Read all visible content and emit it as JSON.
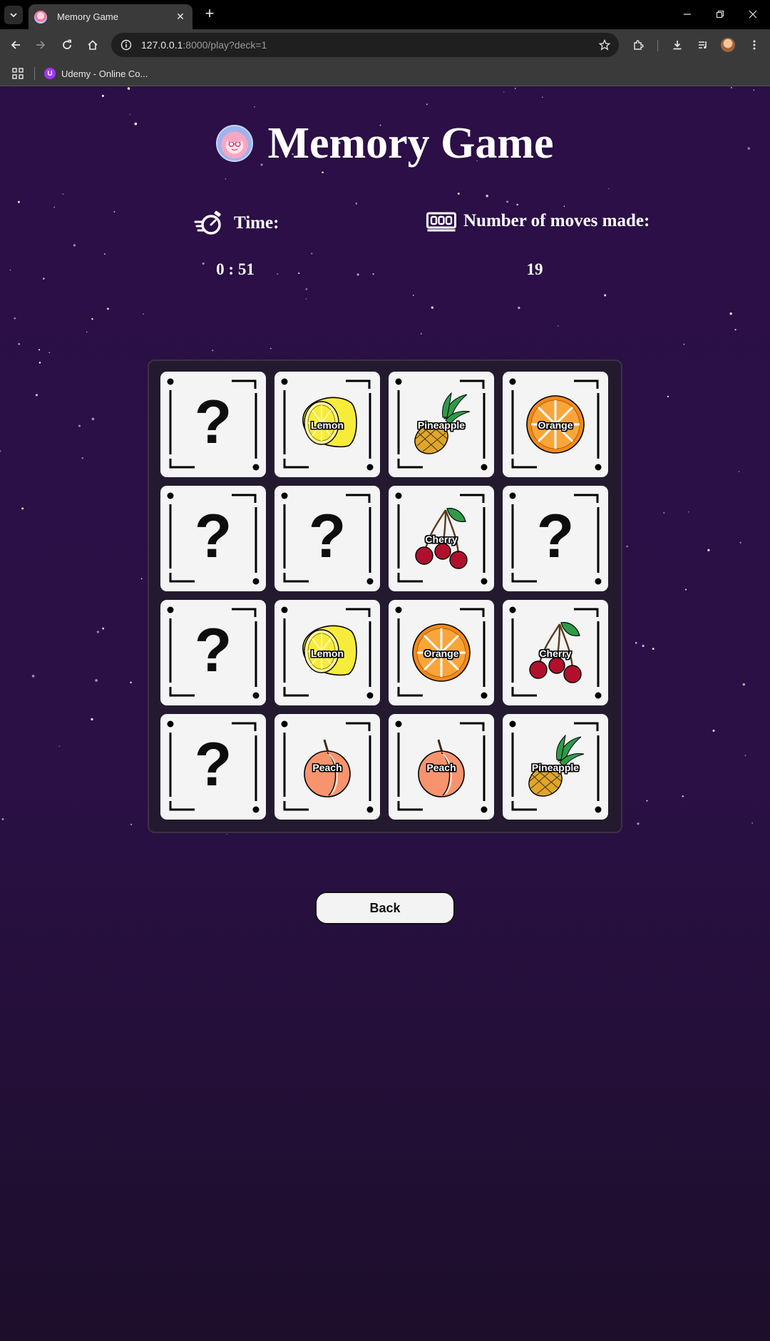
{
  "browser": {
    "tab_title": "Memory Game",
    "url_host": "127.0.0.1",
    "url_rest": ":8000/play?deck=1",
    "bookmark_label": "Udemy - Online Co...",
    "bookmark_icon_letter": "U"
  },
  "game": {
    "title": "Memory Game",
    "time_label": "Time:",
    "time_value": "0 : 51",
    "moves_label": "Number of moves made:",
    "moves_value": "19",
    "back_label": "Back"
  },
  "cards": [
    {
      "fruit": "hidden",
      "label": "?"
    },
    {
      "fruit": "lemon",
      "label": "Lemon"
    },
    {
      "fruit": "pineapple",
      "label": "Pineapple"
    },
    {
      "fruit": "orange",
      "label": "Orange"
    },
    {
      "fruit": "hidden",
      "label": "?"
    },
    {
      "fruit": "hidden",
      "label": "?"
    },
    {
      "fruit": "cherry",
      "label": "Cherry"
    },
    {
      "fruit": "hidden",
      "label": "?"
    },
    {
      "fruit": "hidden",
      "label": "?"
    },
    {
      "fruit": "lemon",
      "label": "Lemon"
    },
    {
      "fruit": "orange",
      "label": "Orange"
    },
    {
      "fruit": "cherry",
      "label": "Cherry"
    },
    {
      "fruit": "hidden",
      "label": "?"
    },
    {
      "fruit": "peach",
      "label": "Peach"
    },
    {
      "fruit": "peach",
      "label": "Peach"
    },
    {
      "fruit": "pineapple",
      "label": "Pineapple"
    }
  ],
  "colors": {
    "background": "#2b0f46",
    "card": "#f4f4f4",
    "lemon": "#f7ec3a",
    "orange": "#f28a1c",
    "cherry": "#b0102c",
    "peach": "#f7946e",
    "pineapple": "#e0a62b",
    "leaf": "#2f9a47"
  }
}
